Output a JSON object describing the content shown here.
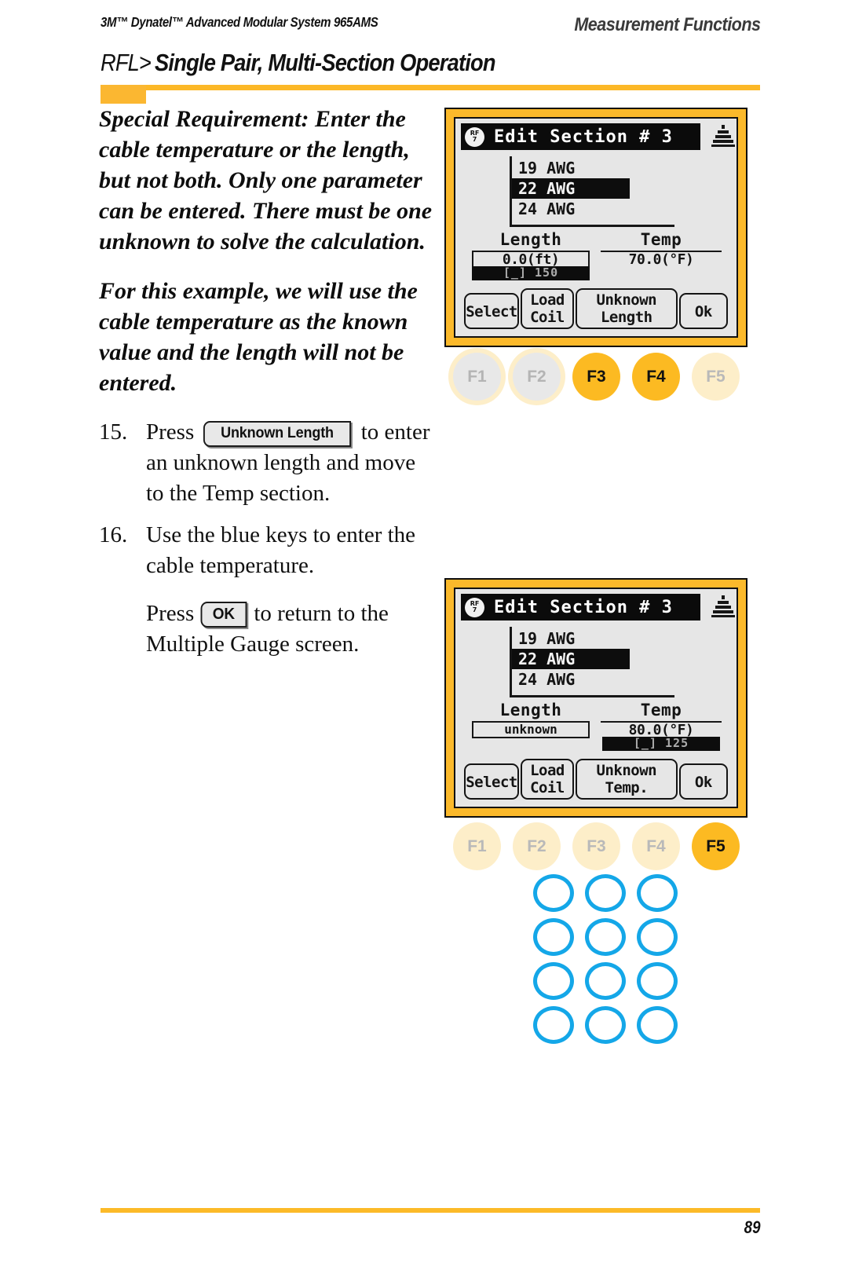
{
  "header": {
    "left": "3M™ Dynatel™ Advanced Modular System 965AMS",
    "right": "Measurement Functions",
    "title_prefix": "RFL>",
    "title_main": "Single Pair, Multi-Section Operation"
  },
  "body": {
    "para1": "Special Requirement: Enter the cable temperature or the length, but not both. Only one parameter can be entered. There must be one unknown to solve the calculation.",
    "para2": "For this example, we will use the cable temperature as the known value and the length will not be entered.",
    "step15": {
      "number": "15.",
      "before": "Press",
      "key": "Unknown Length",
      "after": "to enter an unknown length and move to the Temp section."
    },
    "step16": {
      "number": "16.",
      "text": "Use the blue keys to enter the cable temperature.",
      "sub_before": "Press",
      "sub_key": "OK",
      "sub_after": "to return to the Multiple Gauge screen."
    }
  },
  "screen1": {
    "badge_top": "RF",
    "badge_bottom": "7",
    "title": "Edit Section #  3",
    "awg": [
      "19 AWG",
      "22 AWG",
      "24 AWG"
    ],
    "awg_selected_index": 1,
    "length_label": "Length",
    "length_value": "0.0(ft)",
    "length_cursor": "[_] 150",
    "temp_label": "Temp",
    "temp_value": "70.0(°F)",
    "softkeys": [
      "Select",
      "Load\nCoil",
      "Unknown\nLength",
      "Ok"
    ],
    "fkeys": [
      {
        "label": "F1",
        "state": "ring"
      },
      {
        "label": "F2",
        "state": "ring"
      },
      {
        "label": "F3",
        "state": "active"
      },
      {
        "label": "F4",
        "state": "active"
      },
      {
        "label": "F5",
        "state": "dim"
      }
    ]
  },
  "screen2": {
    "badge_top": "RF",
    "badge_bottom": "7",
    "title": "Edit Section #  3",
    "awg": [
      "19 AWG",
      "22 AWG",
      "24 AWG"
    ],
    "awg_selected_index": 1,
    "length_label": "Length",
    "length_value": "unknown",
    "temp_label": "Temp",
    "temp_value": "80.0(°F)",
    "temp_cursor": "[_] 125",
    "softkeys": [
      "Select",
      "Load\nCoil",
      "Unknown\nTemp.",
      "Ok"
    ],
    "fkeys": [
      {
        "label": "F1",
        "state": "dim"
      },
      {
        "label": "F2",
        "state": "dim"
      },
      {
        "label": "F3",
        "state": "dim"
      },
      {
        "label": "F4",
        "state": "dim"
      },
      {
        "label": "F5",
        "state": "active"
      }
    ]
  },
  "keypad": {
    "rows": 4,
    "cols": 3
  },
  "footer": {
    "page_number": "89"
  },
  "colors": {
    "amber": "#FCBA22",
    "amber_light": "#fdeec9",
    "keypad_blue": "#14A7E8",
    "lcd_bg": "#e6e6e6",
    "lcd_ink": "#0d0d0d"
  }
}
